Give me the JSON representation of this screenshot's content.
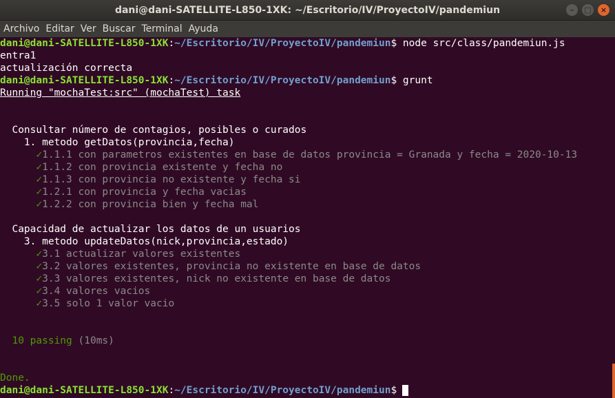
{
  "window": {
    "title": "dani@dani-SATELLITE-L850-1XK: ~/Escritorio/IV/ProyectoIV/pandemiun"
  },
  "menu": [
    "Archivo",
    "Editar",
    "Ver",
    "Buscar",
    "Terminal",
    "Ayuda"
  ],
  "prompt": {
    "user": "dani@dani-SATELLITE-L850-1XK",
    "path": "~/Escritorio/IV/ProyectoIV/pandemiun",
    "symbol": "$"
  },
  "cmd1": "node src/class/pandemiun.js",
  "out1": [
    "entra1",
    "actualización correcta"
  ],
  "cmd2": "grunt",
  "running": "Running \"mochaTest:src\" (mochaTest) task",
  "suite1": {
    "title": "Consultar número de contagios, posibles o curados",
    "sub": "1. metodo getDatos(provincia,fecha)",
    "tests": [
      "1.1.1 con parametros existentes en base de datos provincia = Granada y fecha = 2020-10-13",
      "1.1.2 con provincia existente y fecha no",
      "1.1.3 con provincia no existente y fecha si",
      "1.2.1 con provincia y fecha vacias",
      "1.2.2 con provincia bien y fecha mal"
    ]
  },
  "suite2": {
    "title": "Capacidad de actualizar los datos de un usuarios",
    "sub": "3. metodo updateDatos(nick,provincia,estado)",
    "tests": [
      "3.1 actualizar valores existentes",
      "3.2 valores existentes, provincia no existente en base de datos",
      "3.3 valores existentes, nick no existente en base de datos",
      "3.4 valores vacios",
      "3.5 solo 1 valor vacio"
    ]
  },
  "passing": "10 passing",
  "duration": "(10ms)",
  "done": "Done.",
  "check_glyph": "✓",
  "colors": {
    "bg": "#300a24",
    "user": "#8ae234",
    "path": "#729fcf",
    "check": "#4e9a06",
    "pending": "#8a8a8a"
  }
}
